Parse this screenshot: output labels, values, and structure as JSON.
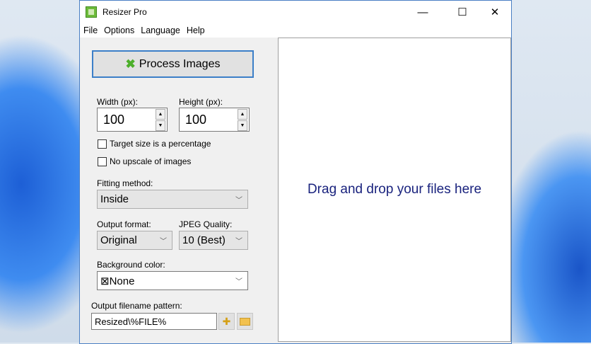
{
  "window": {
    "title": "Resizer Pro",
    "minimize": "—",
    "maximize": "☐",
    "close": "✕"
  },
  "menu": [
    "File",
    "Options",
    "Language",
    "Help"
  ],
  "process_button": "Process Images",
  "width": {
    "label": "Width (px):",
    "value": "100"
  },
  "height": {
    "label": "Height (px):",
    "value": "100"
  },
  "checkboxes": [
    {
      "label": "Target size is a percentage",
      "checked": false
    },
    {
      "label": "No upscale of images",
      "checked": false
    }
  ],
  "fitting": {
    "label": "Fitting method:",
    "value": "Inside"
  },
  "format": {
    "label": "Output format:",
    "value": "Original"
  },
  "quality": {
    "label": "JPEG Quality:",
    "value": "10 (Best)"
  },
  "background": {
    "label": "Background color:",
    "value": "None"
  },
  "pattern": {
    "label": "Output filename pattern:",
    "value": "Resized\\%FILE%"
  },
  "drop_text": "Drag and drop your files here"
}
